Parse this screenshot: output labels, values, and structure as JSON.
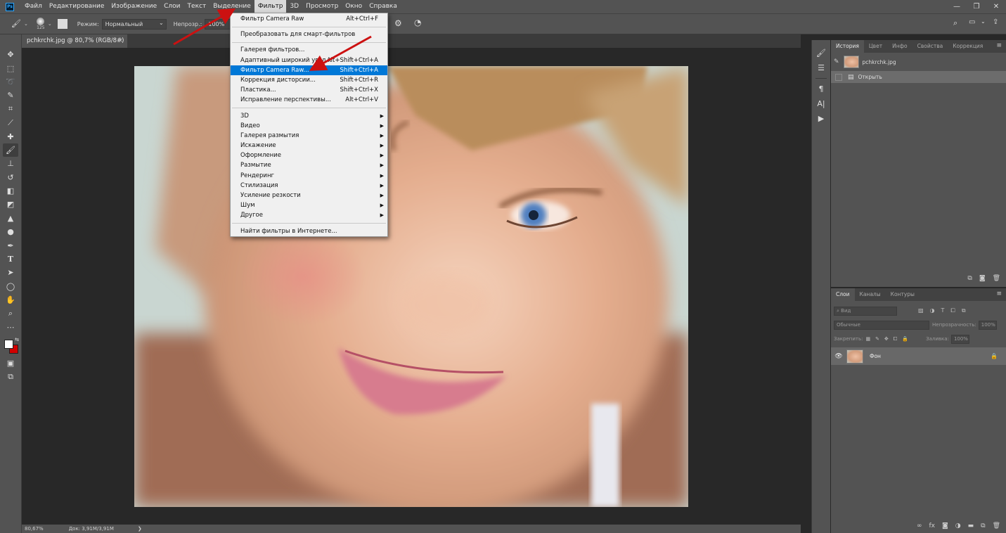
{
  "menubar": {
    "items": [
      "Файл",
      "Редактирование",
      "Изображение",
      "Слои",
      "Текст",
      "Выделение",
      "Фильтр",
      "3D",
      "Просмотр",
      "Окно",
      "Справка"
    ],
    "active_index": 6
  },
  "options": {
    "brush_size": "125",
    "mode_label": "Режим:",
    "mode_value": "Нормальный",
    "opacity_label": "Непрозр.:",
    "opacity_value": "100%"
  },
  "document": {
    "tab_title": "pchkrchk.jpg @ 80,7% (RGB/8#)",
    "close": "×"
  },
  "status": {
    "zoom": "80,67%",
    "doc_size": "Док: 3,91M/3,91M",
    "arrow": "❯"
  },
  "filter_menu": [
    {
      "label": "Фильтр Camera Raw",
      "shortcut": "Alt+Ctrl+F",
      "submenu": false,
      "highlighted": false
    },
    {
      "separator": true
    },
    {
      "label": "Преобразовать для смарт-фильтров",
      "shortcut": "",
      "submenu": false,
      "highlighted": false
    },
    {
      "separator": true
    },
    {
      "label": "Галерея фильтров...",
      "shortcut": "",
      "submenu": false,
      "highlighted": false
    },
    {
      "label": "Адаптивный широкий угол...",
      "shortcut": "Alt+Shift+Ctrl+A",
      "submenu": false,
      "highlighted": false
    },
    {
      "label": "Фильтр Camera Raw...",
      "shortcut": "Shift+Ctrl+A",
      "submenu": false,
      "highlighted": true
    },
    {
      "label": "Коррекция дисторсии...",
      "shortcut": "Shift+Ctrl+R",
      "submenu": false,
      "highlighted": false
    },
    {
      "label": "Пластика...",
      "shortcut": "Shift+Ctrl+X",
      "submenu": false,
      "highlighted": false
    },
    {
      "label": "Исправление перспективы...",
      "shortcut": "Alt+Ctrl+V",
      "submenu": false,
      "highlighted": false
    },
    {
      "separator": true
    },
    {
      "label": "3D",
      "shortcut": "",
      "submenu": true,
      "highlighted": false
    },
    {
      "label": "Видео",
      "shortcut": "",
      "submenu": true,
      "highlighted": false
    },
    {
      "label": "Галерея размытия",
      "shortcut": "",
      "submenu": true,
      "highlighted": false
    },
    {
      "label": "Искажение",
      "shortcut": "",
      "submenu": true,
      "highlighted": false
    },
    {
      "label": "Оформление",
      "shortcut": "",
      "submenu": true,
      "highlighted": false
    },
    {
      "label": "Размытие",
      "shortcut": "",
      "submenu": true,
      "highlighted": false
    },
    {
      "label": "Рендеринг",
      "shortcut": "",
      "submenu": true,
      "highlighted": false
    },
    {
      "label": "Стилизация",
      "shortcut": "",
      "submenu": true,
      "highlighted": false
    },
    {
      "label": "Усиление резкости",
      "shortcut": "",
      "submenu": true,
      "highlighted": false
    },
    {
      "label": "Шум",
      "shortcut": "",
      "submenu": true,
      "highlighted": false
    },
    {
      "label": "Другое",
      "shortcut": "",
      "submenu": true,
      "highlighted": false
    },
    {
      "separator": true
    },
    {
      "label": "Найти фильтры в Интернете...",
      "shortcut": "",
      "submenu": false,
      "highlighted": false
    }
  ],
  "history_panel": {
    "tabs": [
      "История",
      "Цвет",
      "Инфо",
      "Свойства",
      "Коррекция"
    ],
    "file_name": "pchkrchk.jpg",
    "steps": [
      "Открыть"
    ]
  },
  "layers_panel": {
    "tabs": [
      "Слои",
      "Каналы",
      "Контуры"
    ],
    "filter_placeholder": "Вид",
    "blend_mode": "Обычные",
    "opacity_label": "Непрозрачность:",
    "opacity_value": "100%",
    "lock_label": "Закрепить:",
    "fill_label": "Заливка:",
    "fill_value": "100%",
    "layers": [
      {
        "name": "Фон"
      }
    ]
  },
  "colors": {
    "foreground": "#ffffff",
    "background": "#d10000",
    "highlight": "#0078d7",
    "annotation_arrow": "#cc1111"
  }
}
